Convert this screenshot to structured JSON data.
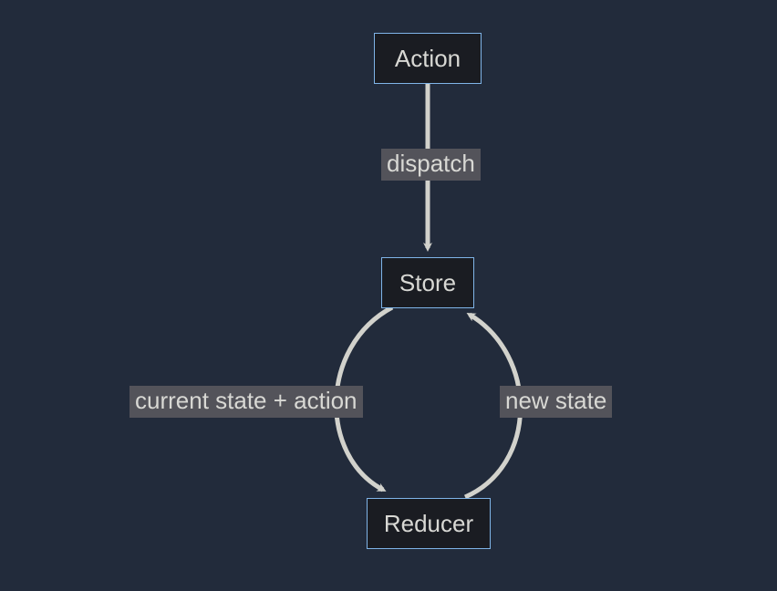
{
  "nodes": {
    "action": {
      "label": "Action"
    },
    "store": {
      "label": "Store"
    },
    "reducer": {
      "label": "Reducer"
    }
  },
  "edges": {
    "action_store": {
      "from": "action",
      "to": "store",
      "label": "dispatch"
    },
    "store_reducer": {
      "from": "store",
      "to": "reducer",
      "label": "current state + action"
    },
    "reducer_store": {
      "from": "reducer",
      "to": "store",
      "label": "new state"
    }
  },
  "colors": {
    "background": "#222b3b",
    "node_fill": "#1a1c22",
    "node_border": "#7fb4e8",
    "text": "#d8d8d4",
    "label_bg": "#53535a",
    "arrow": "#d2d2cc"
  }
}
